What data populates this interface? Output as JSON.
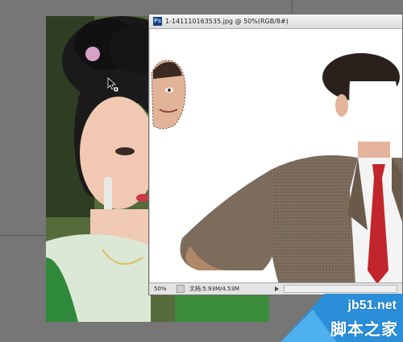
{
  "document": {
    "title": "1-141110163535.jpg @ 50%(RGB/8#)",
    "app_icon_label": "Ps"
  },
  "status_bar": {
    "zoom": "50%",
    "doc_info": "文档:5.93M/4.53M"
  },
  "watermark": {
    "domain": "jb51.net",
    "site_name": "脚本之家"
  },
  "colors": {
    "workspace": "#767676",
    "tie": "#c0262c",
    "suit": "#7a6a5a",
    "watermark_blue": "#2a8fd8"
  },
  "icons": {
    "cursor": "move-cursor-icon",
    "app": "photoshop-icon"
  }
}
